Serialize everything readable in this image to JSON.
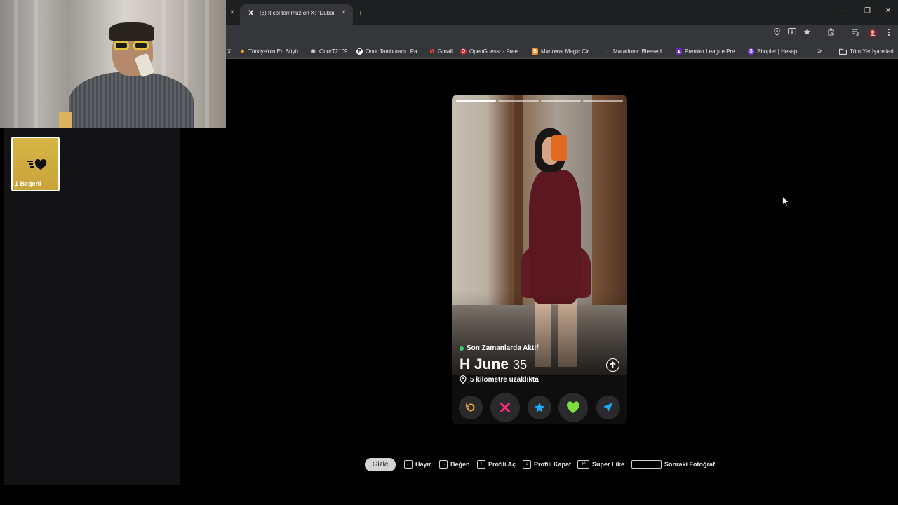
{
  "browser": {
    "tab_title": "(3) It col temmuz on X: \"Dubai ...",
    "tab_icon": "X",
    "new_tab": "+",
    "tab_close": "×",
    "prev_tab_close": "×",
    "window": {
      "minimize": "–",
      "restore": "❐",
      "close": "✕"
    }
  },
  "bookmarks": {
    "items": [
      {
        "label": "X",
        "icon": "",
        "color": "#ffffff"
      },
      {
        "label": "Türkiye'nin En Büyü...",
        "icon": "◆",
        "color": "#e0a030"
      },
      {
        "label": "OnurT2109",
        "icon": "◉",
        "color": "#cfcfcf"
      },
      {
        "label": "Onur Tamburacı | Pa...",
        "icon": "P",
        "color": "#ffffff"
      },
      {
        "label": "Gmail",
        "icon": "M",
        "color": "#ea4335"
      },
      {
        "label": "OpenGuessr - Free...",
        "icon": "O",
        "color": "#d9232e"
      },
      {
        "label": "Manowar.Magic.Cir...",
        "icon": "B",
        "color": "#f08a24"
      },
      {
        "label": "Maradona: Blessed...",
        "icon": "◌",
        "color": "#7b6cf0"
      },
      {
        "label": "Premier League Pre...",
        "icon": "▲",
        "color": "#6a2ab8"
      },
      {
        "label": "Shopier | Hesap",
        "icon": "S",
        "color": "#7d3cf0"
      }
    ],
    "overflow": "»",
    "all_bookmarks": "Tüm Yer İşaretleri"
  },
  "left_panel": {
    "likes_label": "1 Beğeni"
  },
  "profile": {
    "status": "Son Zamanlarda Aktif",
    "name": "H June",
    "age": "35",
    "distance": "5 kilometre uzaklıkta",
    "photo_count": 4,
    "active_photo": 1
  },
  "actions": [
    {
      "name": "rewind-button",
      "icon": "rewind-icon",
      "color": "#f2a33a"
    },
    {
      "name": "nope-button",
      "icon": "x-icon",
      "color": "#fe2b76"
    },
    {
      "name": "super-like-button",
      "icon": "star-icon",
      "color": "#1fa9f3"
    },
    {
      "name": "like-button",
      "icon": "heart-icon",
      "color": "#7edc3d"
    },
    {
      "name": "boost-button",
      "icon": "send-icon",
      "color": "#1fa9f3"
    }
  ],
  "shortcuts": {
    "hide": "Gizle",
    "no": "Hayır",
    "like": "Beğen",
    "open_profile": "Profili Aç",
    "close_profile": "Profili Kapat",
    "super_like": "Super Like",
    "next_photo": "Sonraki Fotoğraf"
  }
}
